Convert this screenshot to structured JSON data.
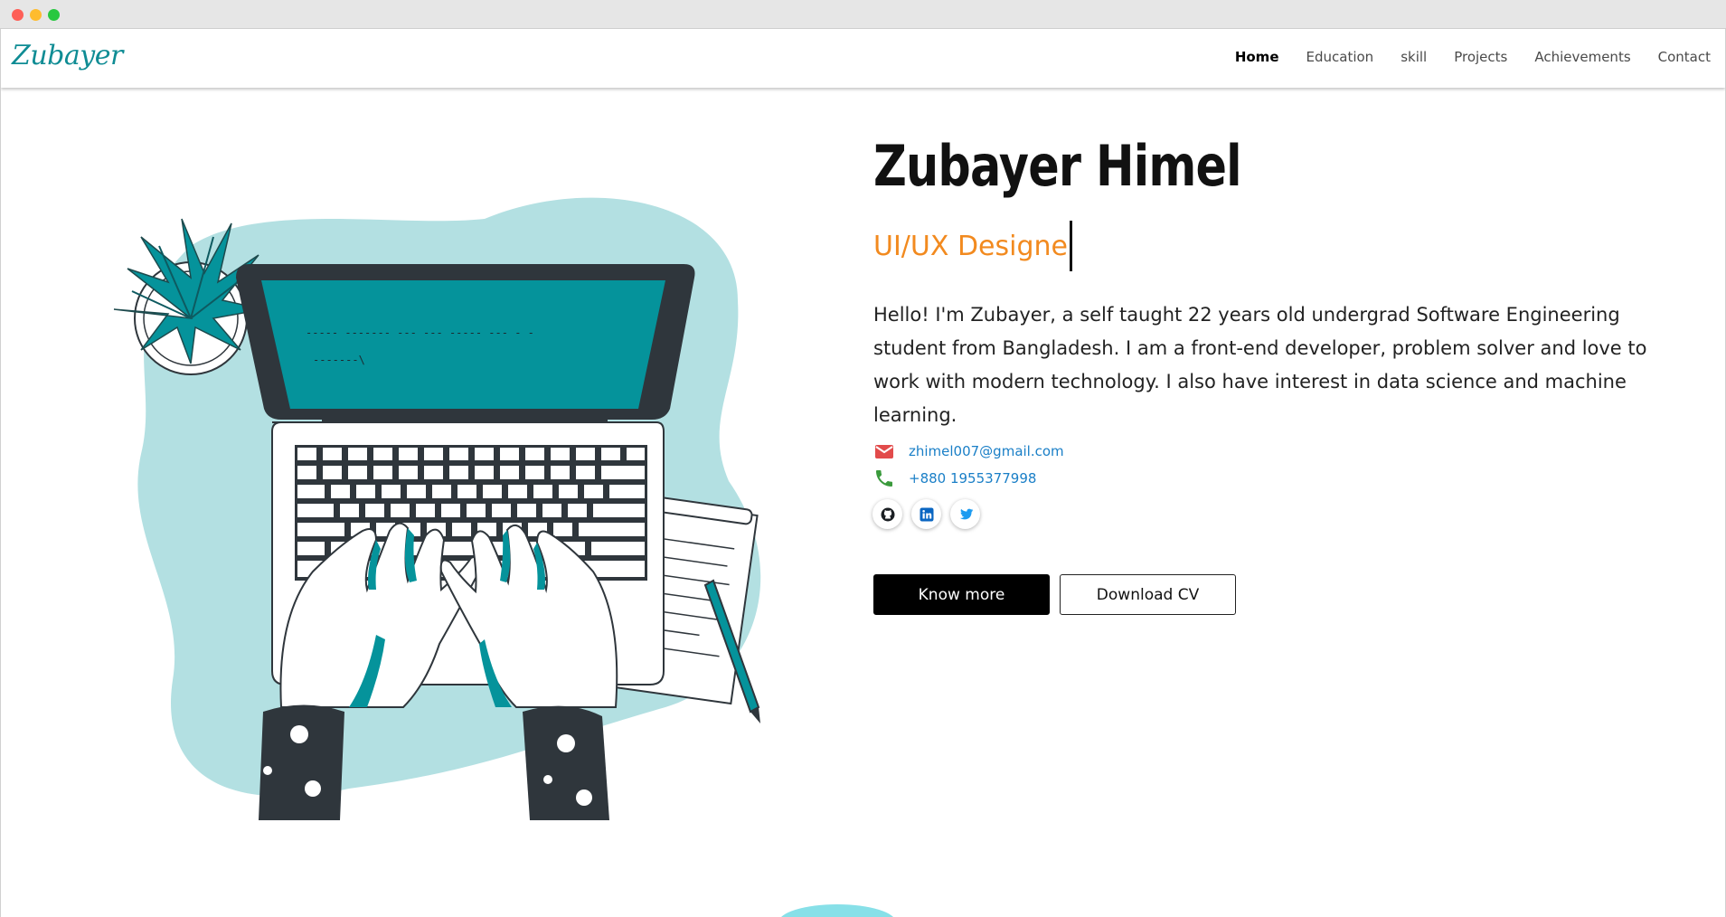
{
  "window": {
    "controls": [
      "close",
      "minimize",
      "maximize"
    ]
  },
  "navbar": {
    "logo": "Zubayer",
    "links": [
      {
        "label": "Home",
        "active": true
      },
      {
        "label": "Education",
        "active": false
      },
      {
        "label": "skill",
        "active": false
      },
      {
        "label": "Projects",
        "active": false
      },
      {
        "label": "Achievements",
        "active": false
      },
      {
        "label": "Contact",
        "active": false
      }
    ]
  },
  "hero": {
    "name": "Zubayer Himel",
    "role": "UI/UX Designe",
    "bio": "Hello! I'm Zubayer, a self taught 22 years old undergrad Software Engineering student from Bangladesh. I am a front-end developer, problem solver and love to work with modern technology. I also have interest in data science and machine learning.",
    "email": "zhimel007@gmail.com",
    "phone": "+880 1955377998",
    "socials": [
      {
        "icon": "github-icon"
      },
      {
        "icon": "linkedin-icon"
      },
      {
        "icon": "twitter-icon"
      }
    ],
    "buttons": {
      "primary": "Know more",
      "secondary": "Download CV"
    }
  },
  "colors": {
    "accent": "#f28a1f",
    "brand": "#0f8c94",
    "link": "#1a7fc7",
    "blob": "#b3e0e2",
    "screen": "#05939b",
    "dark": "#2f363c"
  }
}
